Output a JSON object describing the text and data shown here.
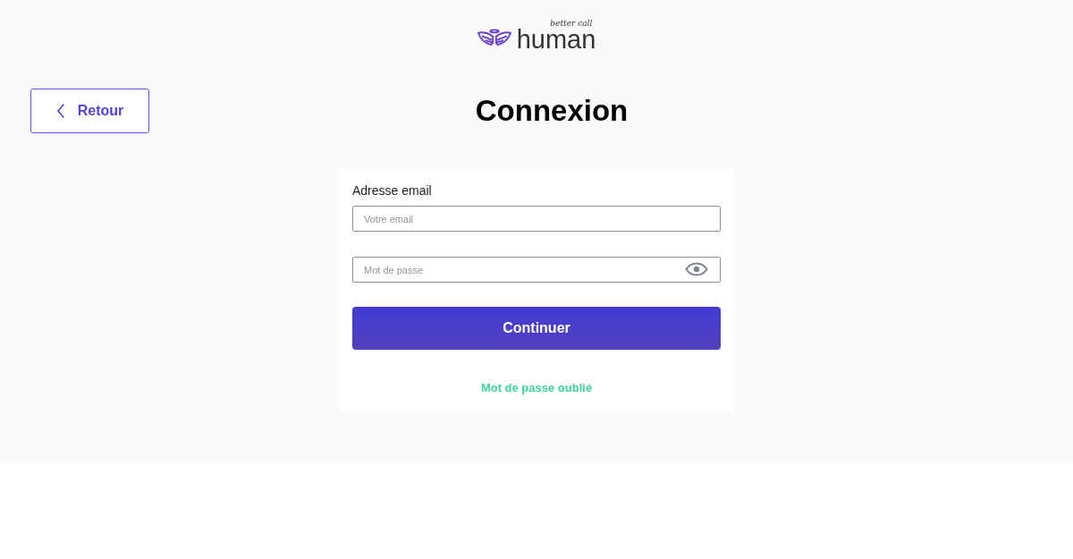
{
  "logo": {
    "tagline": "better call",
    "name": "human"
  },
  "back_button": {
    "label": "Retour"
  },
  "title": "Connexion",
  "form": {
    "email_label": "Adresse email",
    "email_field": {
      "placeholder": "Votre email"
    },
    "password_field": {
      "placeholder": "Mot de passe"
    },
    "submit_button": "Continuer",
    "forgot_link": "Mot de passe oublié"
  }
}
